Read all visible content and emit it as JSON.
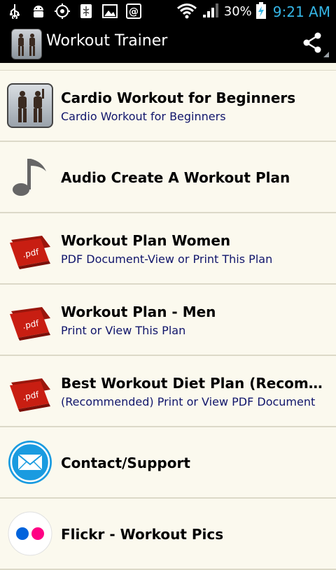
{
  "status_bar": {
    "battery_percent": "30%",
    "time": "9:21 AM"
  },
  "action_bar": {
    "title": "Workout Trainer"
  },
  "items": [
    {
      "title": "Cardio Workout for Beginners",
      "subtitle": "Cardio Workout for Beginners",
      "icon": "workout-photo-icon"
    },
    {
      "title": "Audio Create A Workout Plan",
      "subtitle": "",
      "icon": "music-note-icon"
    },
    {
      "title": "Workout Plan Women",
      "subtitle": "PDF Document-View or Print This Plan",
      "icon": "pdf-icon"
    },
    {
      "title": "Workout Plan - Men",
      "subtitle": "Print or View This Plan",
      "icon": "pdf-icon"
    },
    {
      "title": "Best Workout Diet Plan (Recomm…",
      "subtitle": "(Recommended) Print or View PDF Document",
      "icon": "pdf-icon"
    },
    {
      "title": "Contact/Support",
      "subtitle": "",
      "icon": "mail-icon"
    },
    {
      "title": "Flickr - Workout Pics",
      "subtitle": "",
      "icon": "flickr-icon"
    }
  ],
  "colors": {
    "subtitle": "#10156b",
    "clock": "#35b5e5",
    "pdf_red": "#c81e12",
    "mail_blue": "#1a9be0",
    "flickr_blue": "#0063dc",
    "flickr_pink": "#ff0084"
  }
}
